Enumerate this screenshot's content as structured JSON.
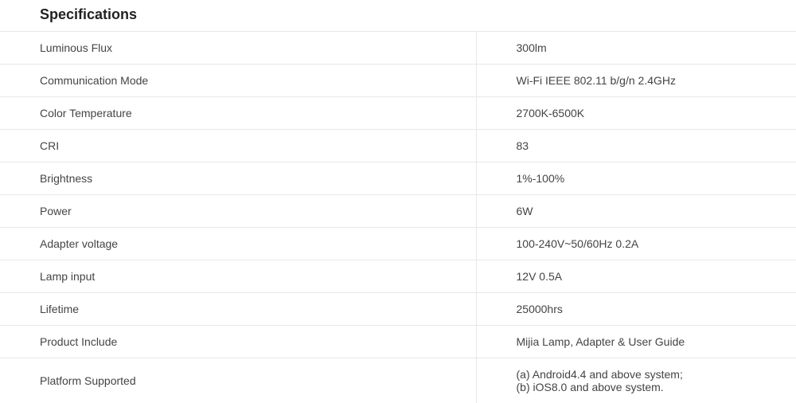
{
  "title": "Specifications",
  "rows": [
    {
      "label": "Luminous Flux",
      "value": "300lm"
    },
    {
      "label": "Communication Mode",
      "value": "Wi-Fi IEEE 802.11 b/g/n 2.4GHz"
    },
    {
      "label": "Color Temperature",
      "value": "2700K-6500K"
    },
    {
      "label": "CRI",
      "value": "83"
    },
    {
      "label": "Brightness",
      "value": "1%-100%"
    },
    {
      "label": "Power",
      "value": "6W"
    },
    {
      "label": "Adapter voltage",
      "value": "100-240V~50/60Hz 0.2A"
    },
    {
      "label": "Lamp input",
      "value": "12V 0.5A"
    },
    {
      "label": "Lifetime",
      "value": "25000hrs"
    },
    {
      "label": "Product Include",
      "value": "Mijia Lamp, Adapter & User Guide"
    },
    {
      "label": "Platform Supported",
      "value": "(a) Android4.4 and above system;\n(b) iOS8.0 and above system."
    }
  ]
}
